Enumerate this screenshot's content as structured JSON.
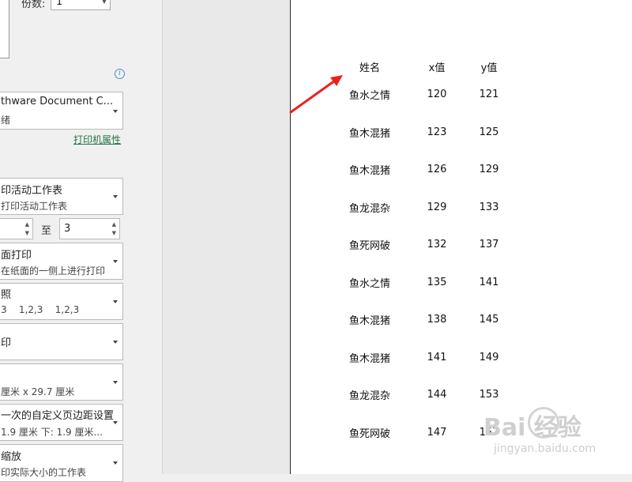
{
  "settings": {
    "copies_label": "份数:",
    "copies_value": "1",
    "printer": {
      "name": "thware Document C...",
      "status": "绪",
      "properties_link": "打印机属性"
    },
    "print_what": {
      "main": "印活动工作表",
      "sub": "打印活动工作表"
    },
    "pages": {
      "from": "",
      "to_label": "至",
      "to": "3"
    },
    "sides": {
      "main": "面打印",
      "sub": "在纸面的一侧上进行打印"
    },
    "collate": {
      "main": "照",
      "sub": "3    1,2,3    1,2,3"
    },
    "orientation": {
      "main": "印",
      "sub": ""
    },
    "paper_size": {
      "main": "",
      "sub": "厘米 x 29.7 厘米"
    },
    "margins": {
      "main": "一次的自定义页边距设置",
      "sub": "1.9 厘米 下: 1.9 厘米..."
    },
    "scaling": {
      "main": "缩放",
      "sub": "印实际大小的工作表"
    }
  },
  "sheet": {
    "headers": [
      "姓名",
      "x值",
      "y值"
    ],
    "rows": [
      {
        "name": "鱼水之情",
        "x": "120",
        "y": "121"
      },
      {
        "name": "鱼木混猪",
        "x": "123",
        "y": "125"
      },
      {
        "name": "鱼木混猪",
        "x": "126",
        "y": "129"
      },
      {
        "name": "鱼龙混杂",
        "x": "129",
        "y": "133"
      },
      {
        "name": "鱼死网破",
        "x": "132",
        "y": "137"
      },
      {
        "name": "鱼水之情",
        "x": "135",
        "y": "141"
      },
      {
        "name": "鱼木混猪",
        "x": "138",
        "y": "145"
      },
      {
        "name": "鱼木混猪",
        "x": "141",
        "y": "149"
      },
      {
        "name": "鱼龙混杂",
        "x": "144",
        "y": "153"
      },
      {
        "name": "鱼死网破",
        "x": "147",
        "y": "157"
      }
    ]
  },
  "watermark": {
    "logo": "Bai  经验",
    "sub": "jingyan.baidu.com"
  },
  "colors": {
    "arrow": "#e8231f",
    "link": "#217346",
    "info": "#4a90d9"
  }
}
